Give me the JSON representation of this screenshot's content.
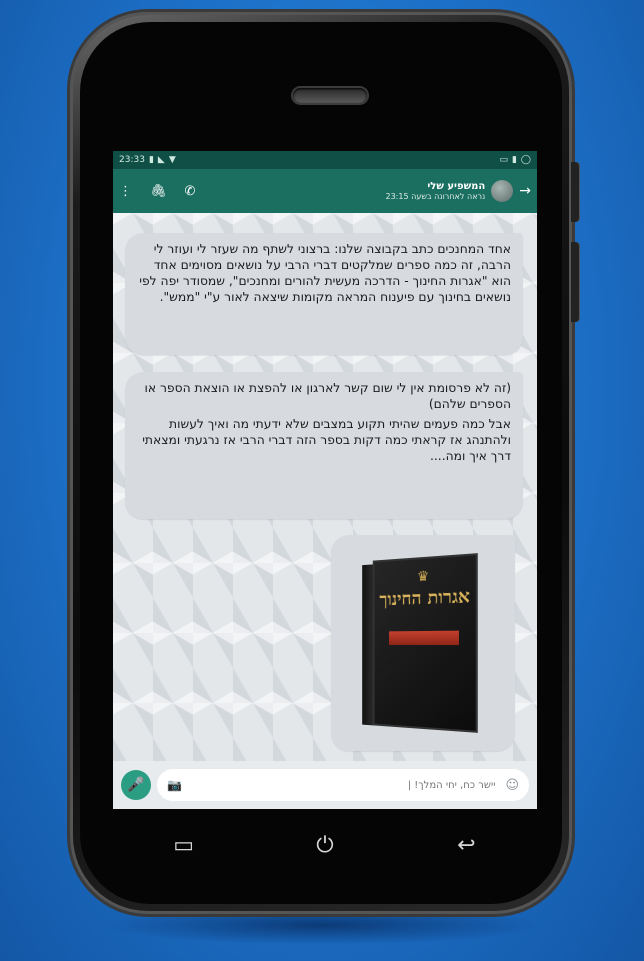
{
  "statusbar": {
    "time": "23:33",
    "left_icons": [
      "notification-icon",
      "signal-icon",
      "wifi-icon"
    ],
    "right_icons": [
      "mute-icon",
      "battery-icon",
      "whatsapp-icon"
    ]
  },
  "appbar": {
    "title": "המשפיע שלי",
    "subtitle": "נראה לאחרונה בשעה 23:15"
  },
  "messages": {
    "m1": "אחד המחנכים כתב בקבוצה שלנו: ברצוני לשתף מה שעזר לי ועוזר לי הרבה, זה כמה ספרים שמלקטים דברי הרבי על נושאים מסוימים אחד הוא \"אגרות החינוך - הדרכה מעשית להורים ומחנכים\", שמסודר יפה לפי נושאים בחינוך עם פיענוח המראה מקומות שיצאה לאור ע\"י \"ממש\".",
    "m2_p1": "(זה לא פרסומת אין לי שום קשר לארגון או להפצת או הוצאת הספר או הספרים שלהם)",
    "m2_p2": "אבל כמה פעמים שהיתי תקוע במצבים שלא ידעתי מה ואיך לעשות ולהתנהג אז קראתי כמה דקות בספר הזה דברי הרבי אז נרגעתי ומצאתי דרך איך ומה....",
    "book_title": "אגרות החינוך",
    "reply_emoji": "👍"
  },
  "composer": {
    "placeholder": "יישר כח, יחי המלך! |"
  },
  "colors": {
    "accent": "#1b6f60",
    "statusbar": "#0f4f45",
    "bubble": "#d7dbe0",
    "reply_bubble": "#e4ebbd",
    "background": "#1c6fc6"
  }
}
